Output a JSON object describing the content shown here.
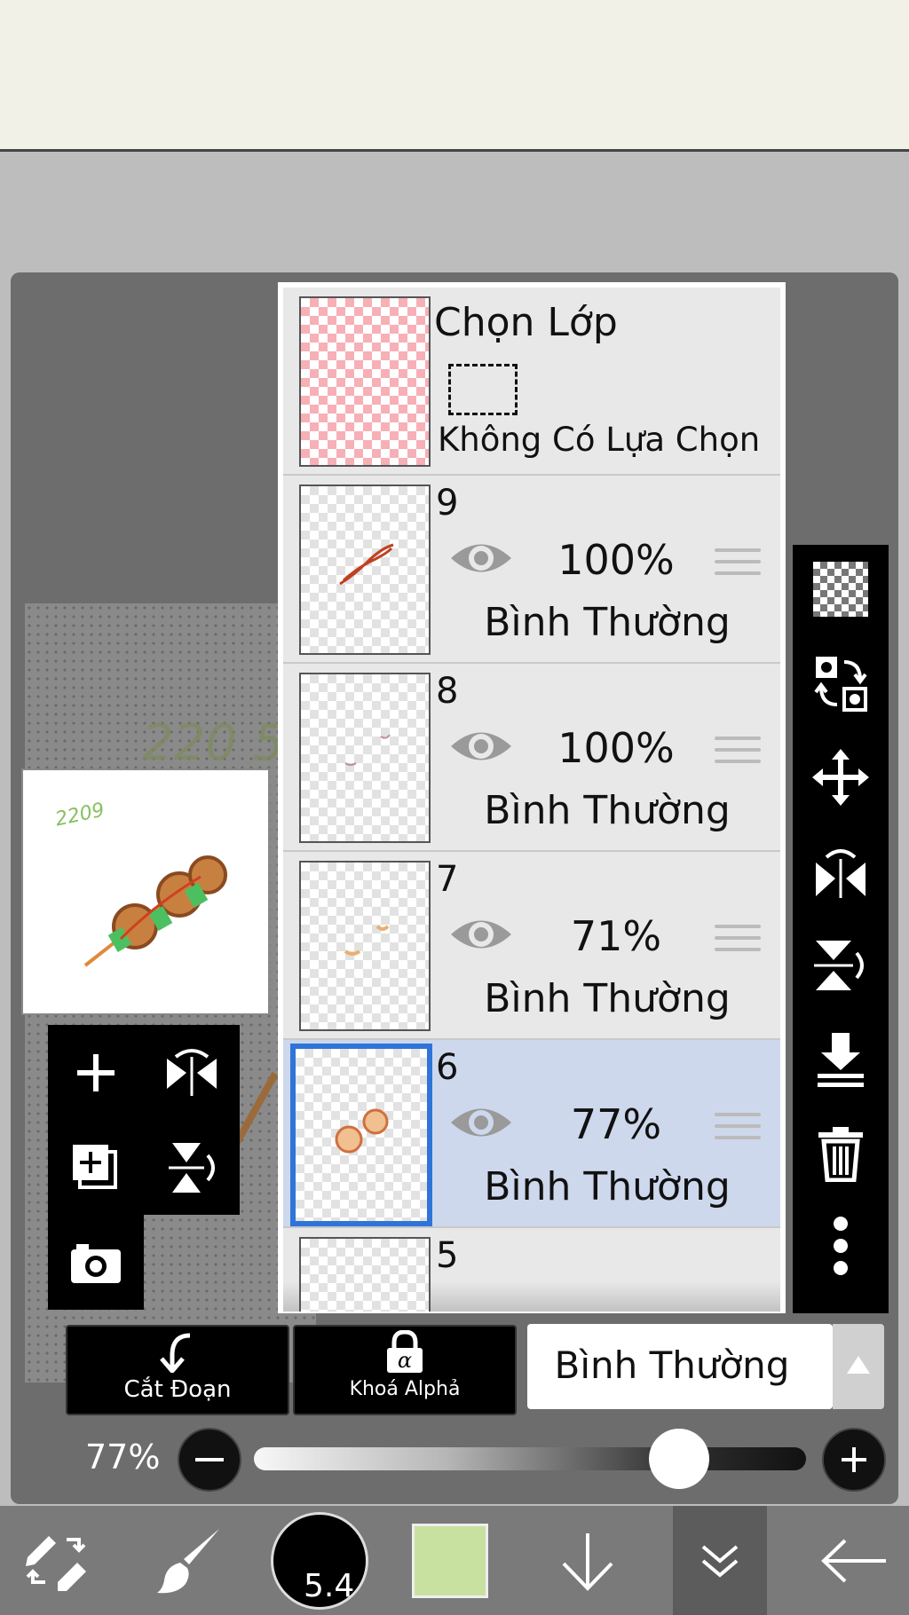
{
  "canvas": {
    "sketch_text": "220 5"
  },
  "navigator": {
    "sketch_text": "2209"
  },
  "selection_layer": {
    "title": "Chọn Lớp",
    "no_selection": "Không Có Lựa Chọn"
  },
  "layers": [
    {
      "number": "9",
      "opacity": "100%",
      "blend": "Bình Thường",
      "selected": false
    },
    {
      "number": "8",
      "opacity": "100%",
      "blend": "Bình Thường",
      "selected": false
    },
    {
      "number": "7",
      "opacity": "71%",
      "blend": "Bình Thường",
      "selected": false
    },
    {
      "number": "6",
      "opacity": "77%",
      "blend": "Bình Thường",
      "selected": true
    },
    {
      "number": "5"
    }
  ],
  "bottom_actions": {
    "clipping_label": "Cắt Đoạn",
    "alpha_lock_label": "Khoá Alphả",
    "blend_mode_value": "Bình Thường"
  },
  "opacity": {
    "label": "77%",
    "value": 0.77
  },
  "brush": {
    "size": "5.4"
  },
  "colors": {
    "current": "#c8e0a0",
    "selected_row": "#cdd8ec",
    "selected_border": "#2f74d8"
  }
}
